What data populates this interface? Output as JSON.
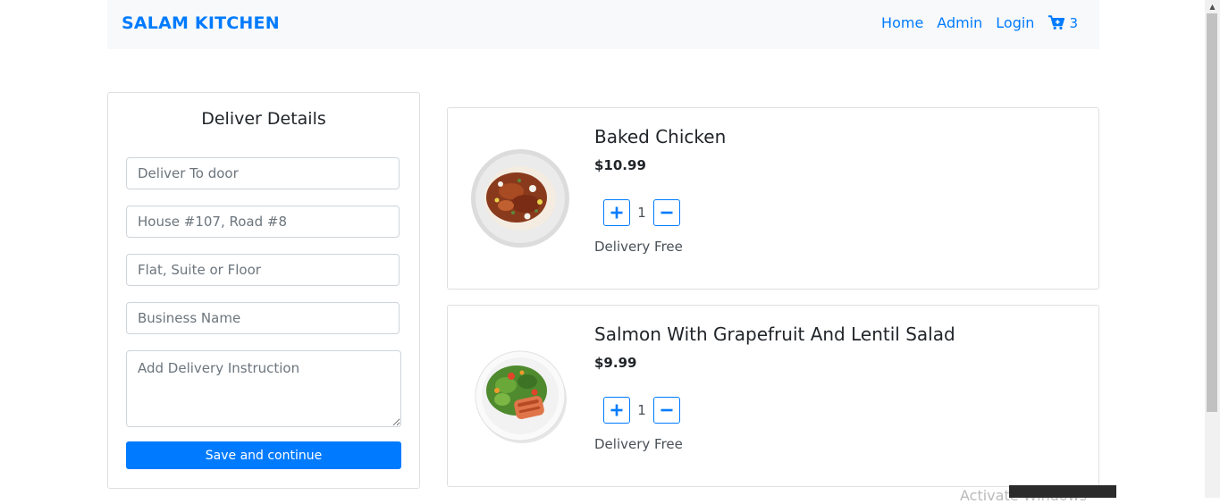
{
  "navbar": {
    "brand": "SALAM KITCHEN",
    "links": [
      "Home",
      "Admin",
      "Login"
    ],
    "cart": {
      "icon": "cart-icon",
      "count": "3"
    }
  },
  "details": {
    "title": "Deliver Details",
    "fields": [
      {
        "placeholder": "Deliver To door"
      },
      {
        "placeholder": "House #107, Road #8"
      },
      {
        "placeholder": "Flat, Suite or Floor"
      },
      {
        "placeholder": "Business Name"
      }
    ],
    "instruction_placeholder": "Add Delivery Instruction",
    "save_label": "Save and continue"
  },
  "cart_items": [
    {
      "name": "Baked Chicken",
      "price": "$10.99",
      "quantity": "1",
      "delivery": "Delivery Free",
      "image": "baked-chicken-plate"
    },
    {
      "name": "Salmon With Grapefruit And Lentil Salad",
      "price": "$9.99",
      "quantity": "1",
      "delivery": "Delivery Free",
      "image": "salmon-salad-plate"
    }
  ],
  "os_overlay": {
    "watermark": "Activate Windows"
  },
  "colors": {
    "primary": "#007bff",
    "navbar_bg": "#f8f9fa",
    "border": "#dfdfdf"
  }
}
